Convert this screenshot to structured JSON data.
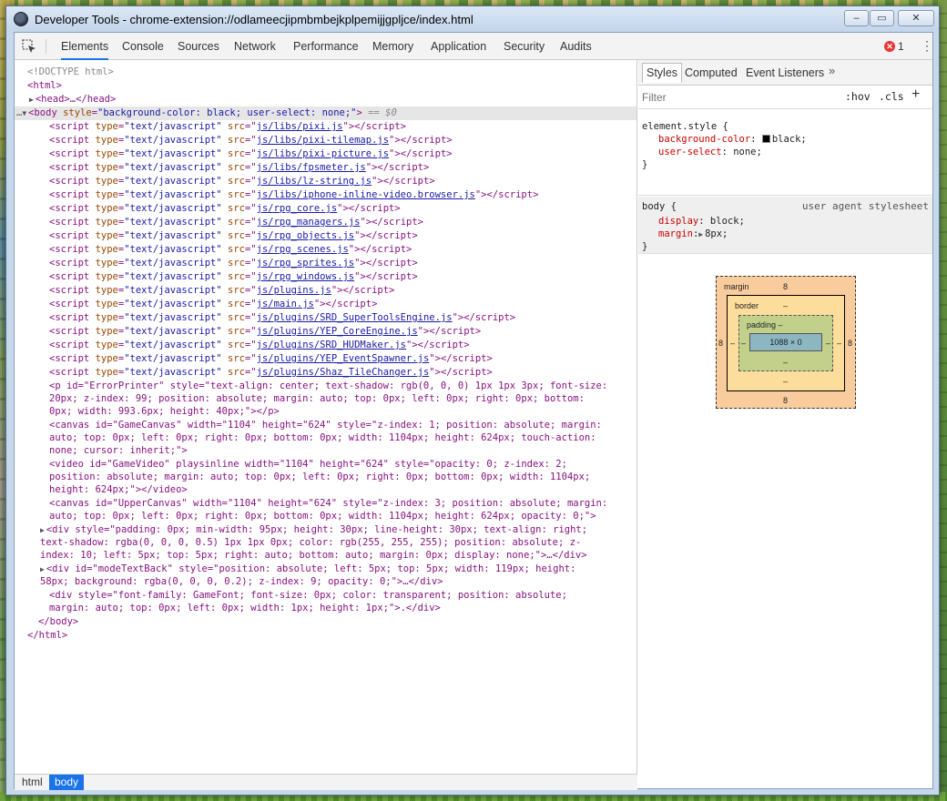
{
  "window": {
    "title": "Developer Tools - chrome-extension://odlameecjipmbmbejkplpemijjgpljce/index.html",
    "min_glyph": "‒",
    "max_glyph": "▭",
    "close_glyph": "✕"
  },
  "toolbar": {
    "tabs": [
      "Elements",
      "Console",
      "Sources",
      "Network",
      "Performance",
      "Memory",
      "Application",
      "Security",
      "Audits"
    ],
    "active_tab": "Elements",
    "error_count": "1"
  },
  "dom": {
    "doctype": "<!DOCTYPE html>",
    "html_open": "<html>",
    "head": "<head>…</head>",
    "body_open_tag": "<body",
    "body_attr_name": "style",
    "body_attr_value": "\"background-color: black; user-select: none;\"",
    "body_selected_note": "== $0",
    "script_srcs": [
      "js/libs/pixi.js",
      "js/libs/pixi-tilemap.js",
      "js/libs/pixi-picture.js",
      "js/libs/fpsmeter.js",
      "js/libs/lz-string.js",
      "js/libs/iphone-inline-video.browser.js",
      "js/rpg_core.js",
      "js/rpg_managers.js",
      "js/rpg_objects.js",
      "js/rpg_scenes.js",
      "js/rpg_sprites.js",
      "js/rpg_windows.js",
      "js/plugins.js",
      "js/main.js",
      "js/plugins/SRD_SuperToolsEngine.js",
      "js/plugins/YEP_CoreEngine.js",
      "js/plugins/SRD_HUDMaker.js",
      "js/plugins/YEP_EventSpawner.js",
      "js/plugins/Shaz_TileChanger.js"
    ],
    "p_lines": [
      "<p id=\"ErrorPrinter\" style=\"text-align: center; text-shadow: rgb(0, 0, 0) 1px 1px 3px; font-size:",
      "20px; z-index: 99; position: absolute; margin: auto; top: 0px; left: 0px; right: 0px; bottom:",
      "0px; width: 993.6px; height: 40px;\"></p>"
    ],
    "canvas_lines": [
      "<canvas id=\"GameCanvas\" width=\"1104\" height=\"624\" style=\"z-index: 1; position: absolute; margin:",
      "auto; top: 0px; left: 0px; right: 0px; bottom: 0px; width: 1104px; height: 624px; touch-action:",
      "none; cursor: inherit;\">"
    ],
    "video_lines": [
      "<video id=\"GameVideo\" playsinline width=\"1104\" height=\"624\" style=\"opacity: 0; z-index: 2;",
      "position: absolute; margin: auto; top: 0px; left: 0px; right: 0px; bottom: 0px; width: 1104px;",
      "height: 624px;\"></video>"
    ],
    "upper_canvas_lines": [
      "<canvas id=\"UpperCanvas\" width=\"1104\" height=\"624\" style=\"z-index: 3; position: absolute; margin:",
      "auto; top: 0px; left: 0px; right: 0px; bottom: 0px; width: 1104px; height: 624px; opacity: 0;\">"
    ],
    "div1_lines": [
      "<div style=\"padding: 0px; min-width: 95px; height: 30px; line-height: 30px; text-align: right;",
      "text-shadow: rgba(0, 0, 0, 0.5) 1px 1px 0px; color: rgb(255, 255, 255); position: absolute; z-",
      "index: 10; left: 5px; top: 5px; right: auto; bottom: auto; margin: 0px; display: none;\">…</div>"
    ],
    "div2_lines": [
      "<div id=\"modeTextBack\" style=\"position: absolute; left: 5px; top: 5px; width: 119px; height:",
      "58px; background: rgba(0, 0, 0, 0.2); z-index: 9; opacity: 0;\">…</div>"
    ],
    "div3_lines": [
      "<div style=\"font-family: GameFont; font-size: 0px; color: transparent; position: absolute;",
      "margin: auto; top: 0px; left: 0px; width: 1px; height: 1px;\">.</div>"
    ],
    "body_close": "</body>",
    "html_close": "</html>"
  },
  "breadcrumbs": [
    "html",
    "body"
  ],
  "styles_pane": {
    "tabs": [
      "Styles",
      "Computed",
      "Event Listeners"
    ],
    "more": "»",
    "filter_placeholder": "Filter",
    "hov": ":hov",
    "cls": ".cls",
    "add": "+",
    "element_style": {
      "selector": "element.style {",
      "props": [
        {
          "name": "background-color",
          "value": "black;"
        },
        {
          "name": "user-select",
          "value": "none;"
        }
      ],
      "close": "}"
    },
    "ua_rule": {
      "selector": "body {",
      "source": "user agent stylesheet",
      "props": [
        {
          "name": "display",
          "value": "block;"
        },
        {
          "name": "margin",
          "value": "8px;"
        }
      ],
      "close": "}"
    }
  },
  "box_model": {
    "margin_label": "margin",
    "margin_top": "8",
    "margin_bottom": "8",
    "margin_left": "8",
    "margin_right": "8",
    "border_label": "border",
    "border_top": "–",
    "border_bottom": "–",
    "border_left": "–",
    "border_right": "–",
    "padding_label": "padding –",
    "padding_bottom": "–",
    "padding_left": "–",
    "padding_right": "–",
    "content": "1088 × 0"
  }
}
